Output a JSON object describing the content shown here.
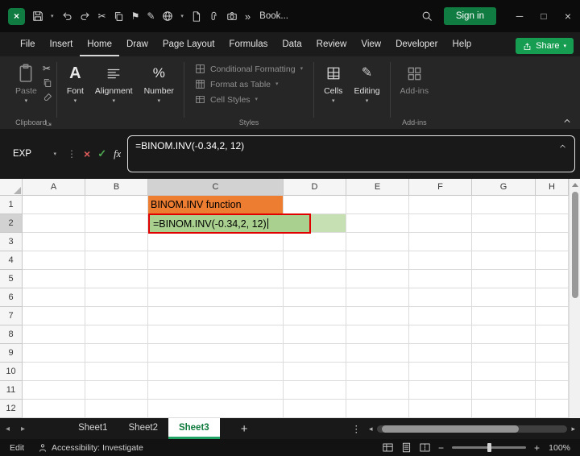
{
  "titlebar": {
    "workbook_name": "Book...",
    "sign_in_label": "Sign in"
  },
  "menubar": {
    "items": [
      "File",
      "Insert",
      "Home",
      "Draw",
      "Page Layout",
      "Formulas",
      "Data",
      "Review",
      "View",
      "Developer",
      "Help"
    ],
    "active_item": "Home",
    "share_label": "Share"
  },
  "ribbon": {
    "paste_label": "Paste",
    "clipboard_group_label": "Clipboard",
    "font_label": "Font",
    "alignment_label": "Alignment",
    "number_label": "Number",
    "styles": {
      "conditional_formatting": "Conditional Formatting",
      "format_as_table": "Format as Table",
      "cell_styles": "Cell Styles",
      "group_label": "Styles"
    },
    "cells_label": "Cells",
    "editing_label": "Editing",
    "addins_label": "Add-ins",
    "addins_group_label": "Add-ins"
  },
  "formula_bar": {
    "name_box_value": "EXP",
    "fx_label": "fx",
    "formula": "=BINOM.INV(-0.34,2, 12)"
  },
  "grid": {
    "column_headers": [
      "A",
      "B",
      "C",
      "D",
      "E",
      "F",
      "G",
      "H"
    ],
    "row_headers": [
      "1",
      "2",
      "3",
      "4",
      "5",
      "6",
      "7",
      "8",
      "9",
      "10",
      "11",
      "12"
    ],
    "active_column": "C",
    "active_row": "2",
    "cells": {
      "c1_text": "BINOM.INV function",
      "c2_text": "=BINOM.INV(-0.34,2, 12)"
    },
    "colors": {
      "c1_fill": "#ED7D31",
      "c2_fill": "#A9D08E",
      "d2_fill": "#C6E0B4",
      "edit_border": "#E00000"
    }
  },
  "sheet_tabs": {
    "tabs": [
      {
        "label": "Sheet1",
        "active": false
      },
      {
        "label": "Sheet2",
        "active": false
      },
      {
        "label": "Sheet3",
        "active": true
      }
    ],
    "add_label": "+"
  },
  "status_bar": {
    "mode": "Edit",
    "accessibility_text": "Accessibility: Investigate",
    "zoom_level": "100%"
  },
  "theme": {
    "logo_green": "#107C41",
    "sign_in_green": "#107C41",
    "share_green": "#179D52",
    "active_tab_text": "#0E7A3D",
    "active_tab_underline": "#21A366"
  },
  "icons": {
    "caret_down": "▾",
    "scissors": "✂",
    "pencil": "✎",
    "flag": "⚑",
    "cancel_x": "×",
    "check": "✓",
    "dots_vertical": "⋮",
    "chevrons_more": "»",
    "minimize": "─",
    "maximize": "□",
    "close": "×",
    "tri_left": "◂",
    "tri_right": "▸",
    "minus": "−",
    "plus": "+",
    "letter_a": "A",
    "percent": "%"
  }
}
